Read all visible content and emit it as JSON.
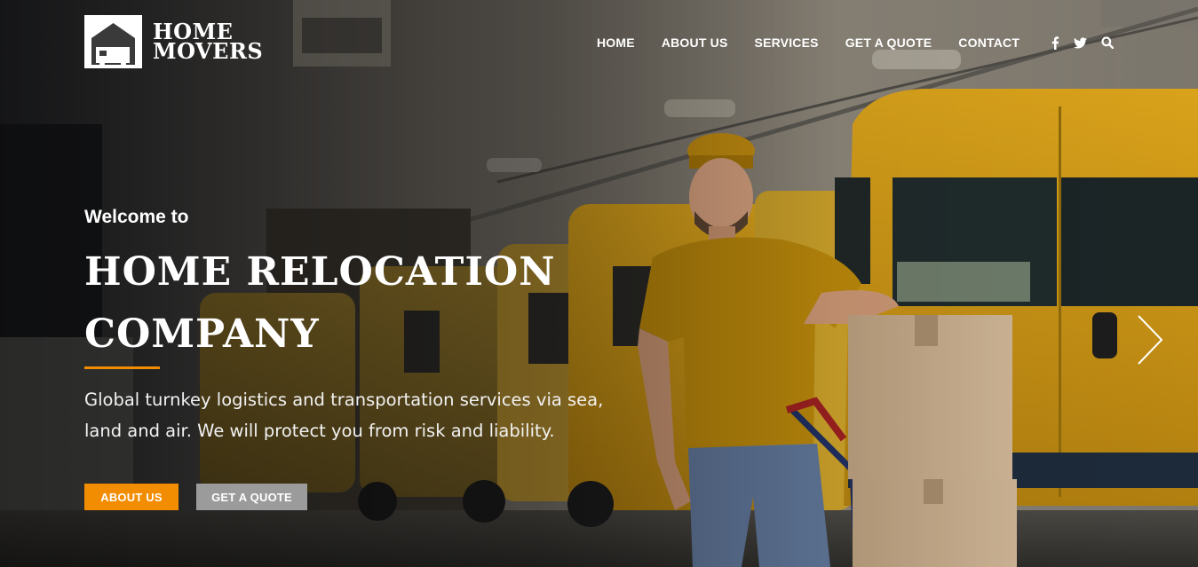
{
  "brand": {
    "name_line1": "HOME",
    "name_line2": "MOVERS",
    "logo_icon": "house-van-icon"
  },
  "nav": {
    "items": [
      {
        "label": "HOME"
      },
      {
        "label": "ABOUT US"
      },
      {
        "label": "SERVICES"
      },
      {
        "label": "GET A QUOTE"
      },
      {
        "label": "CONTACT"
      }
    ],
    "icons": [
      "facebook-icon",
      "twitter-icon",
      "search-icon"
    ]
  },
  "hero": {
    "welcome": "Welcome to",
    "title_line1": "HOME RELOCATION",
    "title_line2": "COMPANY",
    "description": "Global turnkey logistics and transportation services via sea, land and air. We will protect you from risk and liability.",
    "buttons": {
      "primary": "ABOUT US",
      "secondary": "GET A QUOTE"
    },
    "next_icon": "chevron-right-icon"
  },
  "colors": {
    "accent": "#f28c00",
    "secondary_button": "#9b9b9b",
    "text": "#ffffff"
  }
}
